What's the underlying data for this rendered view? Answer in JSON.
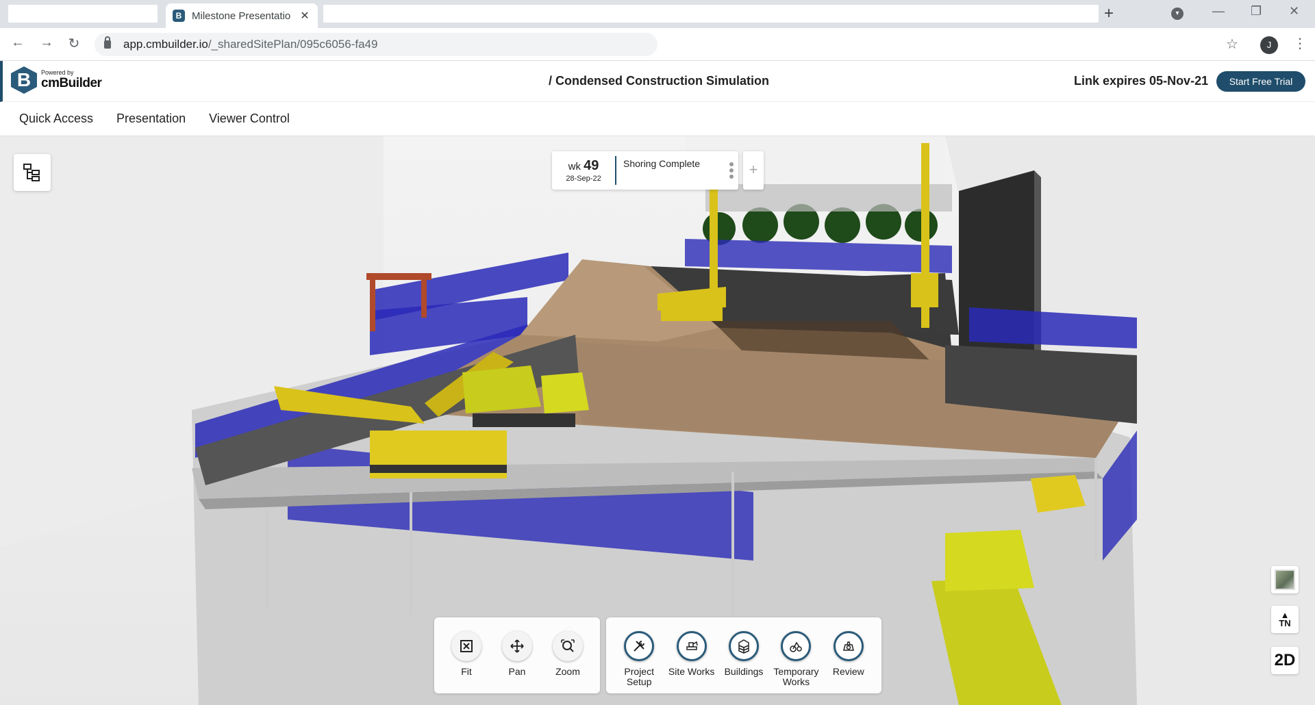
{
  "browser": {
    "tab_title": "Milestone Presentatio",
    "favicon_letter": "B",
    "new_tab_symbol": "+",
    "url_main": "app.cmbuilder.io",
    "url_path": "/_sharedSitePlan/095c6056-fa49",
    "profile_initial": "J"
  },
  "header": {
    "logo_letter": "B",
    "powered_by": "Powered by",
    "logo_name": "cmBuilder",
    "project_title": "/ Condensed Construction Simulation",
    "link_expires": "Link expires 05-Nov-21",
    "trial_button": "Start Free Trial"
  },
  "menu": {
    "items": [
      {
        "label": "Quick Access"
      },
      {
        "label": "Presentation"
      },
      {
        "label": "Viewer Control"
      }
    ]
  },
  "milestone": {
    "wk_prefix": "wk",
    "week": "49",
    "date": "28-Sep-22",
    "title": "Shoring Complete",
    "add_symbol": "+"
  },
  "side": {
    "north_label": "TN",
    "view_mode": "2D"
  },
  "tools_view": [
    {
      "label": "Fit",
      "icon": "fit-icon"
    },
    {
      "label": "Pan",
      "icon": "pan-icon"
    },
    {
      "label": "Zoom",
      "icon": "zoom-icon"
    }
  ],
  "tools_main": [
    {
      "label": "Project Setup",
      "icon": "tools-icon"
    },
    {
      "label": "Site Works",
      "icon": "excavator-icon"
    },
    {
      "label": "Buildings",
      "icon": "building-icon"
    },
    {
      "label": "Temporary Works",
      "icon": "crane-icon"
    },
    {
      "label": "Review",
      "icon": "review-icon"
    }
  ],
  "colors": {
    "brand": "#1f4d6b",
    "fence": "#2a2ab8",
    "machinery": "#d9c21a",
    "ground": "#a88a6a"
  }
}
